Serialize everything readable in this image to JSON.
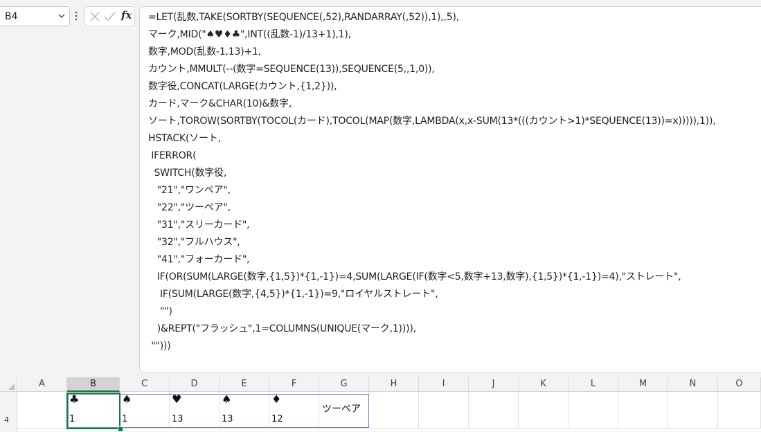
{
  "name_box": {
    "value": "B4"
  },
  "formula_bar": {
    "lines": [
      "=LET(乱数,TAKE(SORTBY(SEQUENCE(,52),RANDARRAY(,52)),1),,5),",
      "マーク,MID(\"♠♥♦♣\",INT((乱数-1)/13+1),1),",
      "数字,MOD(乱数-1,13)+1,",
      "カウント,MMULT(--(数字=SEQUENCE(13)),SEQUENCE(5,,1,0)),",
      "数字役,CONCAT(LARGE(カウント,{1,2})),",
      "カード,マーク&CHAR(10)&数字,",
      "ソート,TOROW(SORTBY(TOCOL(カード),TOCOL(MAP(数字,LAMBDA(x,x-SUM(13*(((カウント>1)*SEQUENCE(13))=x))))),1)),",
      "HSTACK(ソート,",
      " IFERROR(",
      "  SWITCH(数字役,",
      "   \"21\",\"ワンペア\",",
      "   \"22\",\"ツーペア\",",
      "   \"31\",\"スリーカード\",",
      "   \"32\",\"フルハウス\",",
      "   \"41\",\"フォーカード\",",
      "   IF(OR(SUM(LARGE(数字,{1,5})*{1,-1})=4,SUM(LARGE(IF(数字<5,数字+13,数字),{1,5})*{1,-1})=4),\"ストレート\",",
      "    IF(SUM(LARGE(数字,{4,5})*{1,-1})=9,\"ロイヤルストレート\",",
      "    \"\")",
      "   )&REPT(\"フラッシュ\",1=COLUMNS(UNIQUE(マーク,1)))),",
      " \"\")))"
    ]
  },
  "icons": {
    "cancel": "cancel-x-icon",
    "enter": "enter-check-icon",
    "fx": "insert-function-icon",
    "fx_label": "fx"
  },
  "columns": [
    "A",
    "B",
    "C",
    "D",
    "E",
    "F",
    "G",
    "H",
    "I",
    "J",
    "K",
    "L",
    "M",
    "N",
    "O"
  ],
  "row": {
    "label": "4"
  },
  "cells": {
    "B4": {
      "suit": "♣",
      "value": "1"
    },
    "C4": {
      "suit": "♠",
      "value": "1"
    },
    "D4": {
      "suit": "♥",
      "value": "13"
    },
    "E4": {
      "suit": "♠",
      "value": "13"
    },
    "F4": {
      "suit": "♦",
      "value": "12"
    },
    "G4": {
      "text": "ツーペア"
    }
  },
  "colors": {
    "active_cell": "#107c41",
    "spill_border": "#6a86c9",
    "selected_header": "#d3d3d3"
  }
}
